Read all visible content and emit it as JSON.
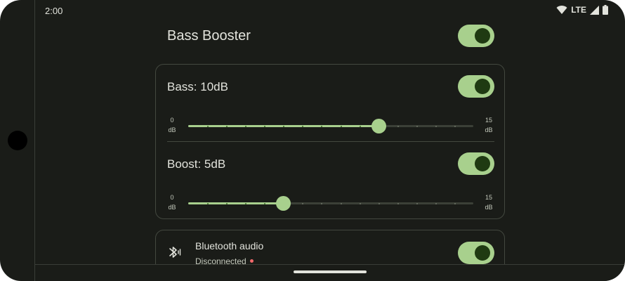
{
  "status_bar": {
    "time": "2:00",
    "network": "LTE",
    "icons": [
      "wifi-icon",
      "cell-signal-icon",
      "battery-icon"
    ]
  },
  "header": {
    "title": "Bass Booster",
    "enabled": true
  },
  "bass": {
    "label": "Bass: 10dB",
    "enabled": true,
    "min_value": "0",
    "min_unit": "dB",
    "max_value": "15",
    "max_unit": "dB",
    "value": 10,
    "range": [
      0,
      15
    ],
    "steps": 15
  },
  "boost": {
    "label": "Boost: 5dB",
    "enabled": true,
    "min_value": "0",
    "min_unit": "dB",
    "max_value": "15",
    "max_unit": "dB",
    "value": 5,
    "range": [
      0,
      15
    ],
    "steps": 15
  },
  "bluetooth": {
    "icon": "bluetooth-audio-icon",
    "title": "Bluetooth audio",
    "status": "Disconnected",
    "status_color": "#f2696b",
    "enabled": true
  },
  "colors": {
    "background": "#1a1c18",
    "accent": "#a8d08d",
    "thumb": "#1f3a12",
    "text": "#e2e3dc",
    "outline": "#43483f"
  }
}
